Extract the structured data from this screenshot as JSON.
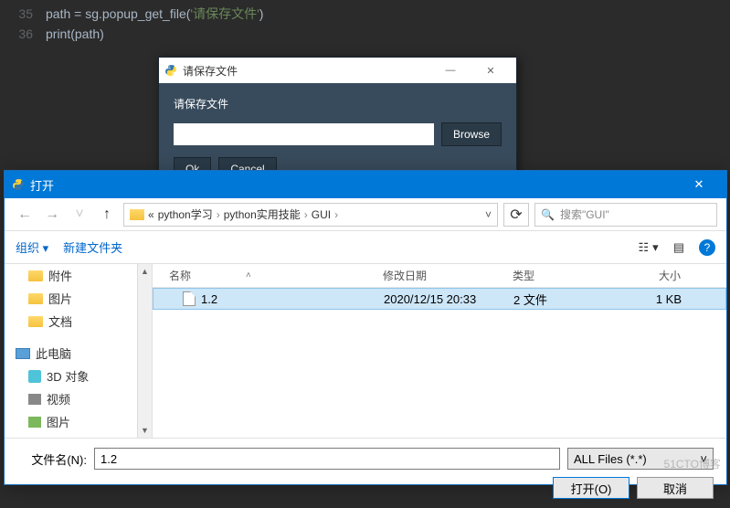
{
  "code": {
    "line1_num": "35",
    "line1_text_a": "path = sg.popup_get_file(",
    "line1_str": "'请保存文件'",
    "line1_text_b": ")",
    "line2_num": "36",
    "line2_text": "print(path)"
  },
  "popup": {
    "title": "请保存文件",
    "label": "请保存文件",
    "browse": "Browse",
    "ok": "Ok",
    "cancel": "Cancel"
  },
  "filedlg": {
    "title": "打开",
    "breadcrumb": {
      "prefix": "«",
      "seg1": "python学习",
      "seg2": "python实用技能",
      "seg3": "GUI"
    },
    "search_placeholder": "搜索\"GUI\"",
    "toolbar": {
      "organize": "组织",
      "newfolder": "新建文件夹"
    },
    "sidebar": {
      "items": [
        {
          "label": "附件"
        },
        {
          "label": "图片"
        },
        {
          "label": "文档"
        }
      ],
      "thispc": "此电脑",
      "pc_items": [
        {
          "label": "3D 对象"
        },
        {
          "label": "视频"
        },
        {
          "label": "图片"
        }
      ]
    },
    "columns": {
      "name": "名称",
      "date": "修改日期",
      "type": "类型",
      "size": "大小"
    },
    "rows": [
      {
        "name": "1.2",
        "date": "2020/12/15 20:33",
        "type": "2 文件",
        "size": "1 KB"
      }
    ],
    "filename_label": "文件名(N):",
    "filename_value": "1.2",
    "filter": "ALL Files (*.*)",
    "open_btn": "打开(O)",
    "cancel_btn": "取消"
  },
  "watermark": "51CTO博客"
}
